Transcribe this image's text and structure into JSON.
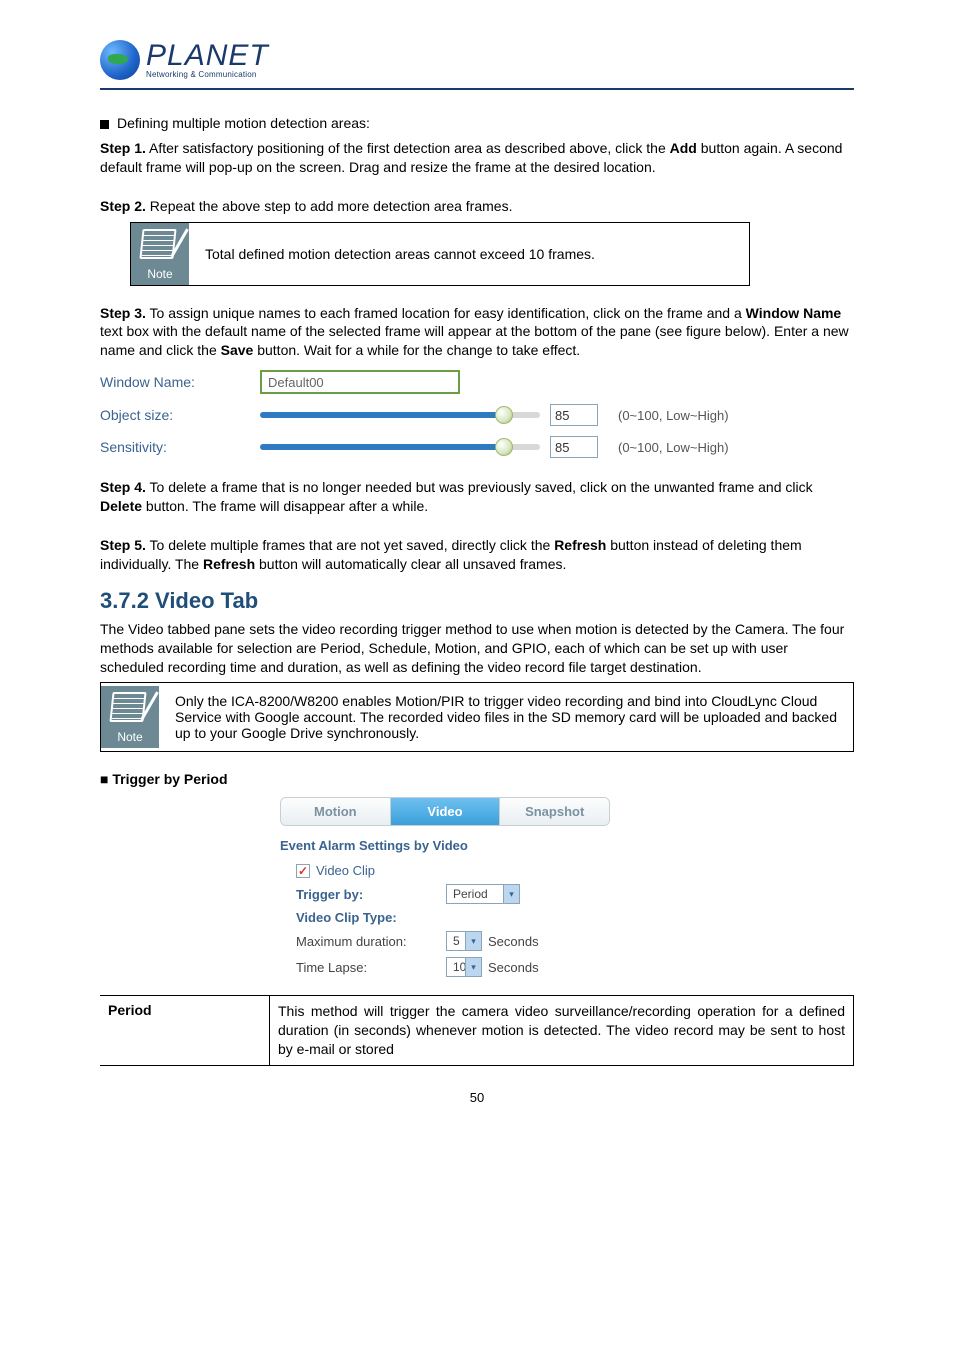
{
  "logo": {
    "main": "PLANET",
    "sub": "Networking & Communication"
  },
  "bullet1": "Defining multiple motion detection areas:",
  "step1": {
    "label": "Step 1.",
    "t1": " After satisfactory positioning of the first detection area as described above, click the ",
    "add": "Add",
    "t2": " button again. A second default frame will pop-up on the screen. Drag and resize the frame at the desired location."
  },
  "step2": {
    "label": "Step 2.",
    "t": " Repeat the above step to add more detection area frames."
  },
  "note1": {
    "label": "Note",
    "text": "Total defined motion detection areas cannot exceed 10 frames."
  },
  "step3": {
    "label": "Step 3.",
    "t1": " To assign unique names to each framed location for easy identification, click on the frame and a ",
    "win": "Window Name",
    "t2": " text box with the default name of the selected frame will appear at the bottom of the pane (see figure below). Enter a new name and click the ",
    "save": "Save",
    "t3": " button. Wait for a while for the change to take effect."
  },
  "ss1": {
    "window_label": "Window Name:",
    "window_value": "Default00",
    "obj_label": "Object size:",
    "obj_val": "85",
    "obj_hint": "(0~100, Low~High)",
    "sens_label": "Sensitivity:",
    "sens_val": "85",
    "sens_hint": "(0~100, Low~High)"
  },
  "step4": {
    "label": "Step 4.",
    "t1": " To delete a frame that is no longer needed but was previously saved, click on the unwanted frame and click ",
    "del": "Delete",
    "t2": " button. The frame will disappear after a while."
  },
  "step5": {
    "label": "Step 5.",
    "t1": " To delete multiple frames that are not yet saved, directly click the ",
    "ref": "Refresh",
    "t2": " button instead of deleting them individually. The ",
    "ref2": "Refresh",
    "t3": " button will automatically clear all unsaved frames."
  },
  "sec_h": "3.7.2 Video Tab",
  "sec_p": "The Video tabbed pane sets the video recording trigger method to use when motion is detected by the Camera. The four methods available for selection are Period, Schedule, Motion, and GPIO, each of which can be set up with user scheduled recording time and duration, as well as defining the video record file target destination.",
  "note2": {
    "label": "Note",
    "text": "Only the ICA-8200/W8200 enables Motion/PIR to trigger video recording and bind into CloudLync Cloud Service with Google account. The recorded video files in the SD memory card will be uploaded and backed up to your Google Drive synchronously."
  },
  "trig_h": "Trigger by Period",
  "ss2": {
    "tabs": {
      "motion": "Motion",
      "video": "Video",
      "snapshot": "Snapshot"
    },
    "title": "Event Alarm Settings by Video",
    "clip_label": "Video Clip",
    "trigger_label": "Trigger by:",
    "trigger_val": "Period",
    "type_label": "Video Clip Type:",
    "maxdur_label": "Maximum duration:",
    "maxdur_val": "5",
    "seconds": "Seconds",
    "lapse_label": "Time Lapse:",
    "lapse_val": "10"
  },
  "table": {
    "left": "Period",
    "right": "This method will trigger the camera video surveillance/recording operation for a defined duration (in seconds) whenever motion is detected. The video record may be sent to host by e-mail or stored"
  },
  "page_number": "50"
}
